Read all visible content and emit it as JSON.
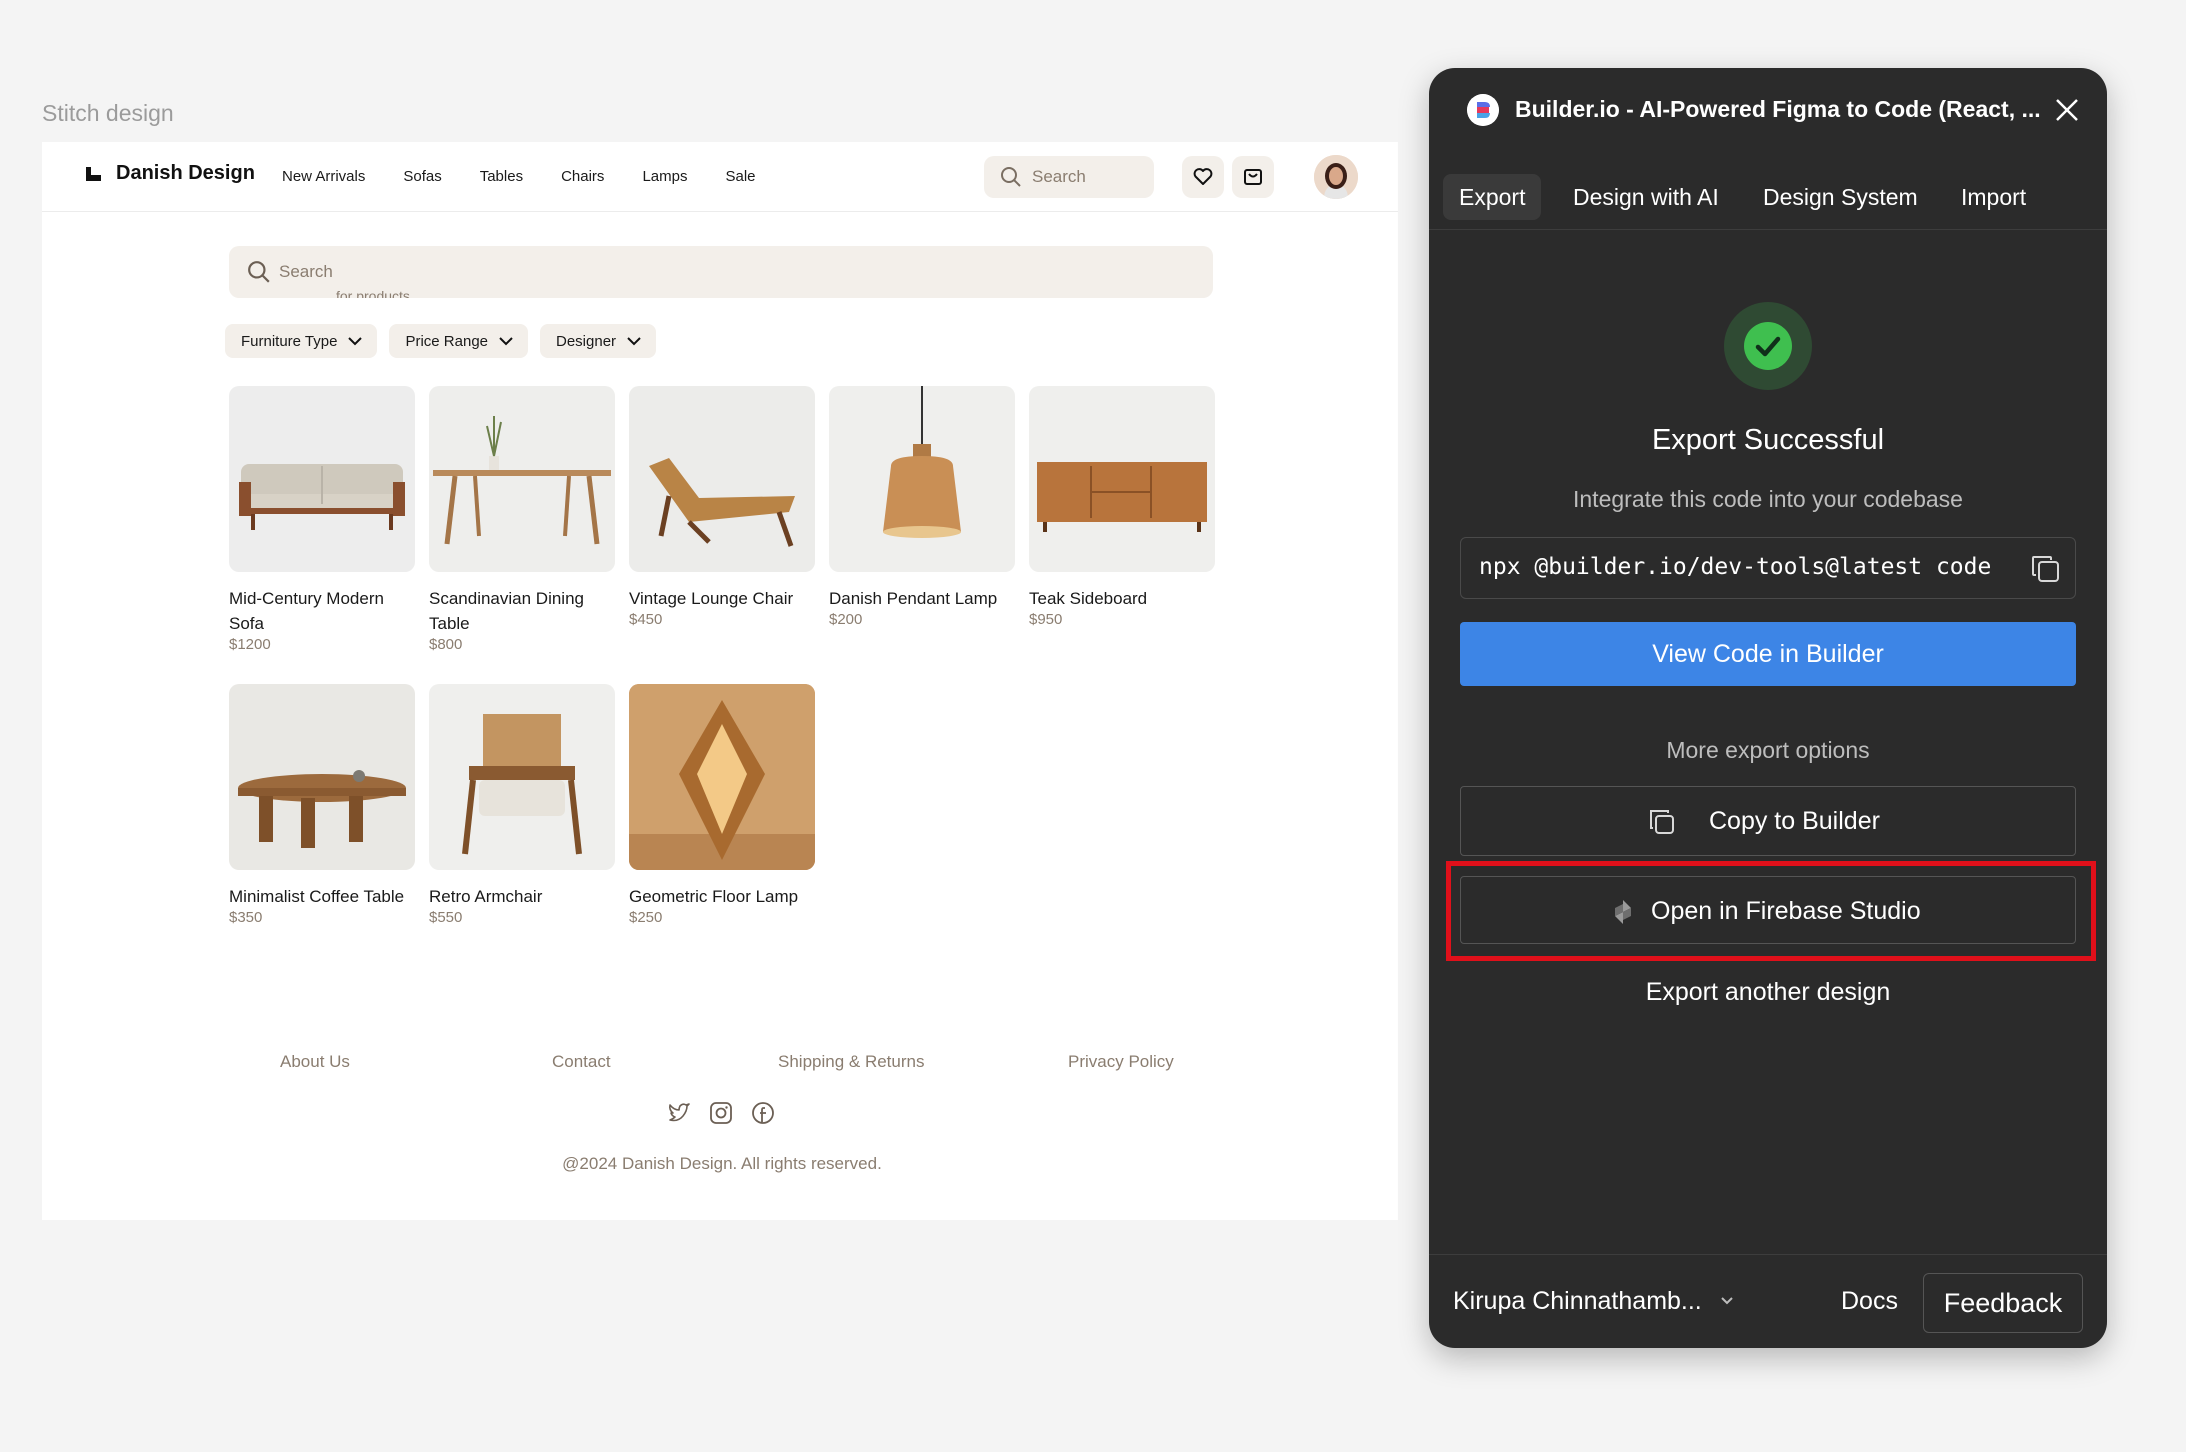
{
  "canvas": {
    "label": "Stitch design"
  },
  "nav": {
    "brand": "Danish Design",
    "links": [
      "New Arrivals",
      "Sofas",
      "Tables",
      "Chairs",
      "Lamps",
      "Sale"
    ],
    "search_placeholder": "Search"
  },
  "main_search": {
    "placeholder": "Search",
    "subtext": "for products"
  },
  "filters": [
    "Furniture Type",
    "Price Range",
    "Designer"
  ],
  "products": [
    {
      "name": "Mid-Century Modern Sofa",
      "price": "$1200",
      "icon": "sofa-image"
    },
    {
      "name": "Scandinavian Dining Table",
      "price": "$800",
      "icon": "dining-table-image"
    },
    {
      "name": "Vintage Lounge Chair",
      "price": "$450",
      "icon": "lounge-chair-image"
    },
    {
      "name": "Danish Pendant Lamp",
      "price": "$200",
      "icon": "pendant-lamp-image"
    },
    {
      "name": "Teak Sideboard",
      "price": "$950",
      "icon": "sideboard-image"
    },
    {
      "name": "Minimalist Coffee Table",
      "price": "$350",
      "icon": "coffee-table-image"
    },
    {
      "name": "Retro Armchair",
      "price": "$550",
      "icon": "armchair-image"
    },
    {
      "name": "Geometric Floor Lamp",
      "price": "$250",
      "icon": "floor-lamp-image"
    }
  ],
  "footer": {
    "links": [
      "About Us",
      "Contact",
      "Shipping & Returns",
      "Privacy Policy"
    ],
    "social": [
      "twitter-icon",
      "instagram-icon",
      "facebook-icon"
    ],
    "copyright": "@2024 Danish Design. All rights reserved."
  },
  "panel": {
    "title": "Builder.io - AI-Powered Figma to Code (React, ...",
    "tabs": [
      "Export",
      "Design with AI",
      "Design System",
      "Import"
    ],
    "active_tab": "Export",
    "success_title": "Export Successful",
    "success_subtitle": "Integrate this code into your codebase",
    "code_command": "npx @builder.io/dev-tools@latest code",
    "view_code_label": "View Code in Builder",
    "more_options_label": "More export options",
    "copy_label": "Copy to Builder",
    "firebase_label": "Open in Firebase Studio",
    "export_another_label": "Export another design",
    "user_name": "Kirupa Chinnathamb...",
    "docs_label": "Docs",
    "feedback_label": "Feedback",
    "colors": {
      "background": "#2b2b2b",
      "primary": "#3d85e6",
      "success": "#3fbf4f",
      "highlight": "#e0101a"
    }
  }
}
